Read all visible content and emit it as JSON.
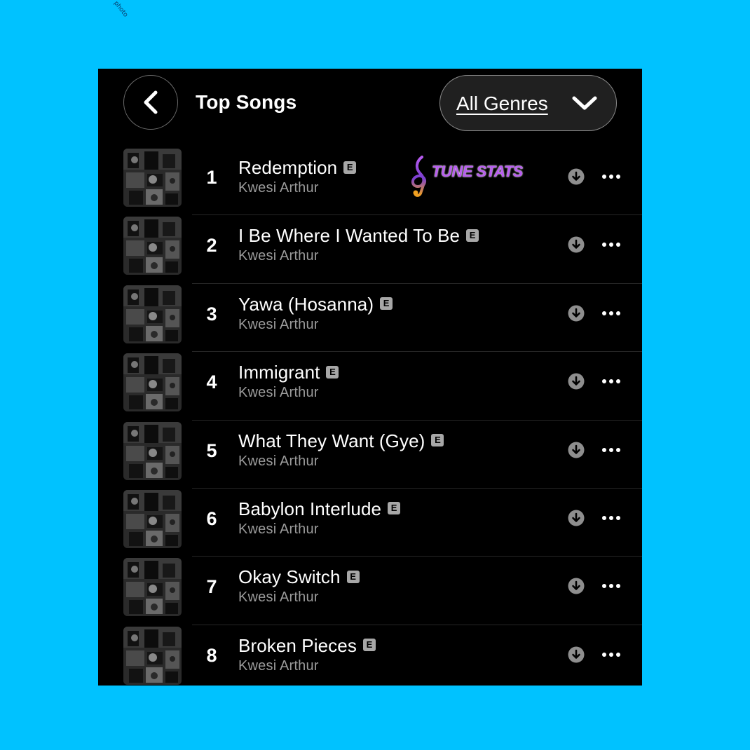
{
  "corner_text": "photo",
  "header": {
    "back_icon": "chevron-left-icon",
    "title": "Top Songs",
    "genre_filter": {
      "label": "All Genres",
      "icon": "chevron-down-icon"
    }
  },
  "watermark": {
    "text": "TUNE STATS",
    "icon": "treble-clef-icon"
  },
  "songs": [
    {
      "rank": "1",
      "title": "Redemption",
      "artist": "Kwesi Arthur",
      "explicit": "E"
    },
    {
      "rank": "2",
      "title": "I Be Where I Wanted To Be",
      "artist": "Kwesi Arthur",
      "explicit": "E"
    },
    {
      "rank": "3",
      "title": "Yawa (Hosanna)",
      "artist": "Kwesi Arthur",
      "explicit": "E"
    },
    {
      "rank": "4",
      "title": "Immigrant",
      "artist": "Kwesi Arthur",
      "explicit": "E"
    },
    {
      "rank": "5",
      "title": "What They Want (Gye)",
      "artist": "Kwesi Arthur",
      "explicit": "E"
    },
    {
      "rank": "6",
      "title": "Babylon Interlude",
      "artist": "Kwesi Arthur",
      "explicit": "E"
    },
    {
      "rank": "7",
      "title": "Okay Switch",
      "artist": "Kwesi Arthur",
      "explicit": "E"
    },
    {
      "rank": "8",
      "title": "Broken Pieces",
      "artist": "Kwesi Arthur",
      "explicit": "E"
    }
  ],
  "row_icons": {
    "download": "download-icon",
    "more": "more-options-icon"
  },
  "colors": {
    "background": "#00c2ff",
    "panel": "#000000",
    "primary_text": "#ffffff",
    "secondary_text": "#9b9b9b",
    "explicit_badge": "#a7a7a7",
    "watermark": "#b85cf0"
  }
}
